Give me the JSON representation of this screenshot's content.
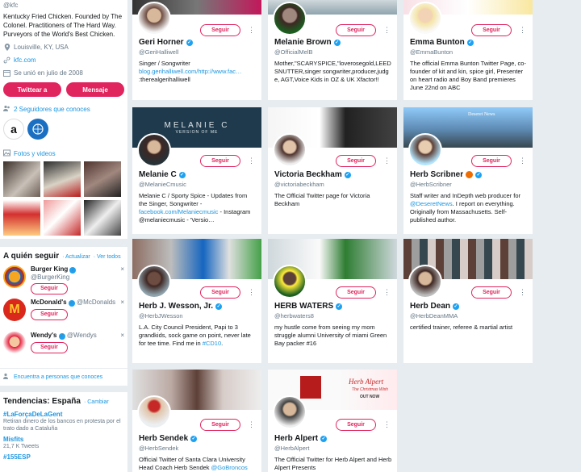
{
  "profile": {
    "handle": "@kfc",
    "bio": "Kentucky Fried Chicken. Founded by The Colonel. Practitioners of The Hard Way. Purveyors of the World's Best Chicken.",
    "location": "Louisville, KY, USA",
    "website": "kfc.com",
    "joined": "Se unió en julio de 2008",
    "tweet_button": "Twittear a",
    "message_button": "Mensaje",
    "followers_known": "2 Seguidores que conoces",
    "media_label": "Fotos y videos"
  },
  "who_to_follow": {
    "title": "A quién seguir",
    "refresh": "· Actualizar",
    "view_all": "· Ver todos",
    "items": [
      {
        "name": "Burger King",
        "handle": "@BurgerKing",
        "button": "Seguir"
      },
      {
        "name": "McDonald's",
        "handle": "@McDonalds",
        "button": "Seguir"
      },
      {
        "name": "Wendy's",
        "handle": "@Wendys",
        "button": "Seguir"
      }
    ],
    "find_people": "Encuentra a personas que conoces"
  },
  "trends": {
    "title": "Tendencias: España",
    "change": "· Cambiar",
    "items": [
      {
        "name": "#LaForçaDeLaGent",
        "desc": "Retiran dinero de los bancos en protesta por el trato dado a Cataluña"
      },
      {
        "name": "Misfits",
        "desc": "21,7 K Tweets"
      },
      {
        "name": "#155ESP",
        "desc": ""
      }
    ]
  },
  "cards": [
    {
      "name": "Geri Horner",
      "handle": "@GeriHalliwell",
      "button": "Seguir",
      "bio": "Singer / Songwriter",
      "link": "blog.gerihalliwell.com/http://www.fac…",
      "bio2": ":therealgerihalliwell"
    },
    {
      "name": "Melanie Brown",
      "handle": "@OfficialMelB",
      "button": "Seguir",
      "bio": "Mother,\"SCARYSPICE,\"loverosegold,LEEDSNUTTER,singer songwriter,producer,judge, AGT,Voice Kids in OZ & UK Xfactor!!",
      "link": "",
      "bio2": ""
    },
    {
      "name": "Emma Bunton",
      "handle": "@EmmaBunton",
      "button": "Seguir",
      "bio": "The official Emma Bunton Twitter Page, co-founder of kit and kin, spice girl, Presenter on heart radio and Boy Band premieres June 22nd on ABC",
      "link": "",
      "bio2": ""
    },
    {
      "name": "Melanie C",
      "handle": "@MelanieCmusic",
      "button": "Seguir",
      "bio": "Melanie C / Sporty Spice - Updates from the Singer, Songwriter -",
      "link": "facebook.com/Melaniecmusic",
      "bio2": "- Instagram @melaniecmusic - 'Versio…",
      "banner_text": "MELANIE C",
      "banner_sub": "VERSION OF ME"
    },
    {
      "name": "Victoria Beckham",
      "handle": "@victoriabeckham",
      "button": "Seguir",
      "bio": "The Official Twitter page for Victoria Beckham",
      "link": "",
      "bio2": ""
    },
    {
      "name": "Herb Scribner",
      "handle": "@HerbScribner",
      "button": "Seguir",
      "bio": "Staff writer and InDepth web producer for",
      "link": "@DeseretNews",
      "bio2": ". I report on everything. Originally from Massachusetts. Self-published author.",
      "banner_text": "Deseret News"
    },
    {
      "name": "Herb J. Wesson, Jr.",
      "handle": "@HerbJWesson",
      "button": "Seguir",
      "bio": "L.A. City Council President, Papi to 3 grandkids, sock game on point, never late for tee time. Find me in",
      "link": "#CD10",
      "bio2": "."
    },
    {
      "name": "HERB WATERS",
      "handle": "@herbwaters8",
      "button": "Seguir",
      "bio": "my hustle come from seeing my mom struggle alumni University of miami Green Bay packer #16",
      "link": "",
      "bio2": ""
    },
    {
      "name": "Herb Dean",
      "handle": "@HerbDeanMMA",
      "button": "Seguir",
      "bio": "certified trainer, referee & martial artist",
      "link": "",
      "bio2": ""
    },
    {
      "name": "Herb Sendek",
      "handle": "@HerbSendek",
      "button": "Seguir",
      "bio": "Official Twitter of Santa Clara University Head Coach Herb Sendek",
      "link": "@GoBroncos",
      "bio2": ""
    },
    {
      "name": "Herb Alpert",
      "handle": "@HerbAlpert",
      "button": "Seguir",
      "bio": "The Official Twitter for Herb Alpert and Herb Alpert Presents",
      "link": "",
      "bio2": "",
      "banner_text": "Herb Alpert",
      "banner_sub": "The Christmas Wish",
      "banner_sub2": "OUT NOW"
    }
  ]
}
